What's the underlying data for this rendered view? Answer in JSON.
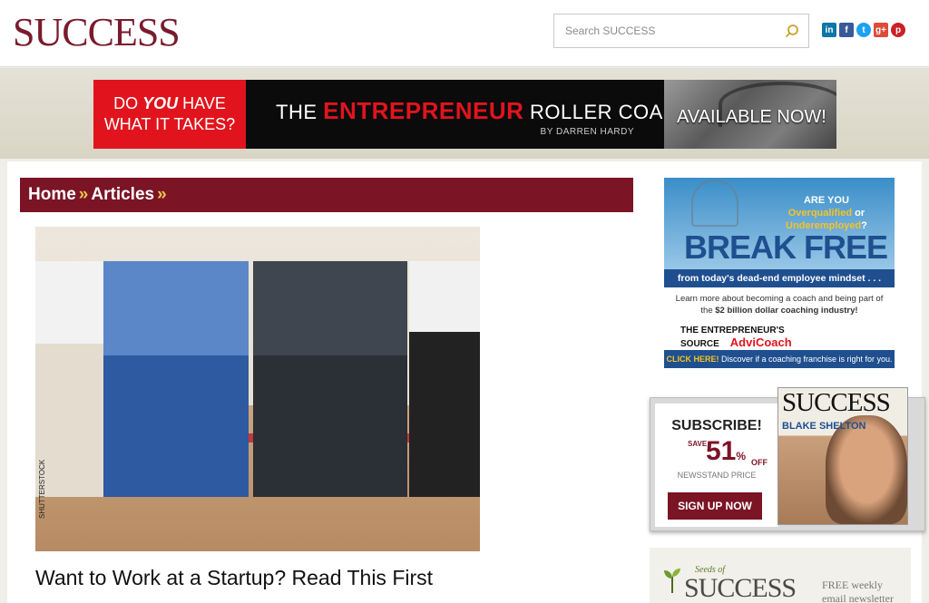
{
  "header": {
    "logo": "SUCCESS",
    "search_placeholder": "Search SUCCESS",
    "social": [
      {
        "name": "linkedin-icon",
        "glyph": "in"
      },
      {
        "name": "facebook-icon",
        "glyph": "f"
      },
      {
        "name": "twitter-icon",
        "glyph": "t"
      },
      {
        "name": "googleplus-icon",
        "glyph": "g+"
      },
      {
        "name": "pinterest-icon",
        "glyph": "p"
      }
    ]
  },
  "banner": {
    "left_pre": "DO ",
    "left_em": "YOU",
    "left_post": " HAVE",
    "left_line2": "WHAT IT TAKES?",
    "title_pre": "THE ",
    "title_red": "ENTREPRENEUR",
    "title_post": " ROLLER COASTER",
    "byline": "BY DARREN HARDY",
    "cta": "AVAILABLE NOW!"
  },
  "breadcrumb": {
    "home": "Home",
    "sep": "»",
    "articles": "Articles",
    "sep2": "»"
  },
  "article": {
    "image_credit": "SHUTTERSTOCK",
    "title": "Want to Work at a Startup? Read This First"
  },
  "ad_break_free": {
    "q1": "ARE YOU",
    "q2_em": "Overqualified",
    "q2_post": " or",
    "q3_em": "Underemployed",
    "q3_post": "?",
    "headline": "BREAK FREE",
    "subline": "from today's dead-end employee mindset . . .",
    "learn_pre": "Learn more about becoming a coach and being part of the ",
    "learn_bold": "$2 billion dollar coaching industry!",
    "logo1": "THE ENTREPRENEUR'S SOURCE",
    "logo2": "AdviCoach",
    "cta_em": "CLICK HERE!",
    "cta_post": " Discover if a coaching franchise is right for you."
  },
  "subscribe": {
    "heading": "SUBSCRIBE!",
    "save": "SAVE",
    "percent": "51",
    "percent_sign": "%",
    "off": "OFF",
    "newsstand": "NEWSSTAND PRICE",
    "button": "SIGN UP NOW",
    "magazine_title": "SUCCESS",
    "cover_name": "BLAKE SHELTON"
  },
  "seeds": {
    "seeds_of": "Seeds of",
    "wordmark": "SUCCESS",
    "free": "FREE weekly",
    "newsletter": "email newsletter"
  }
}
